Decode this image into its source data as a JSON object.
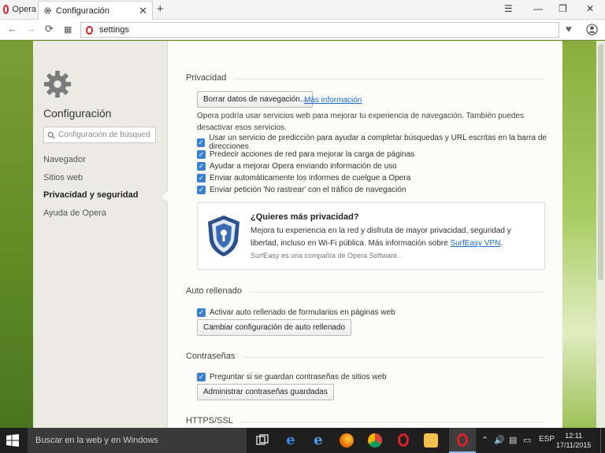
{
  "browser": {
    "tabs": [
      {
        "label": "Opera"
      },
      {
        "label": "Configuración"
      }
    ],
    "address": "settings"
  },
  "sidebar": {
    "title": "Configuración",
    "search_placeholder": "Configuración de búsqued",
    "items": [
      {
        "label": "Navegador",
        "active": false
      },
      {
        "label": "Sitios web",
        "active": false
      },
      {
        "label": "Privacidad y seguridad",
        "active": true
      },
      {
        "label": "Ayuda de Opera",
        "active": false
      }
    ]
  },
  "privacy": {
    "heading": "Privacidad",
    "clear_button": "Borrar datos de navegación...",
    "more_info_link": "Más información",
    "description": "Opera podría usar servicios web para mejorar tu experiencia de navegación. También puedes desactivar esos servicios.",
    "options": [
      {
        "label": "Usar un servicio de predicción para ayudar a completar búsquedas y URL escritas en la barra de direcciones",
        "checked": true
      },
      {
        "label": "Predecir acciones de red para mejorar la carga de páginas",
        "checked": true
      },
      {
        "label": "Ayudar a mejorar Opera enviando información de uso",
        "checked": true
      },
      {
        "label": "Enviar automáticamente los informes de cuelgue a Opera",
        "checked": true
      },
      {
        "label": "Enviar petición 'No rastrear' con el tráfico de navegación",
        "checked": true
      }
    ],
    "promo": {
      "title": "¿Quieres más privacidad?",
      "text": "Mejora tu experiencia en la red y disfruta de mayor privacidad, seguridad y libertad, incluso en Wi-Fi pública. Más información sobre",
      "link": "SurfEasy VPN",
      "text_end": ".",
      "small": "SurfEasy es una compañía de Opera Software."
    }
  },
  "autofill": {
    "heading": "Auto rellenado",
    "option": {
      "label": "Activar auto rellenado de formularios en páginas web",
      "checked": true
    },
    "button": "Cambiar configuración de auto rellenado"
  },
  "passwords": {
    "heading": "Contraseñas",
    "option": {
      "label": "Preguntar si se guardan contraseñas de sitios web",
      "checked": true
    },
    "button": "Administrar contraseñas guardadas"
  },
  "https": {
    "heading": "HTTPS/SSL"
  },
  "taskbar": {
    "search_text": "Buscar en la web y en Windows",
    "language": "ESP",
    "time": "12:11",
    "date": "17/11/2015"
  },
  "colors": {
    "accent_blue": "#3b7fd0",
    "opera_red": "#d8232a",
    "link": "#1a6ac9"
  }
}
